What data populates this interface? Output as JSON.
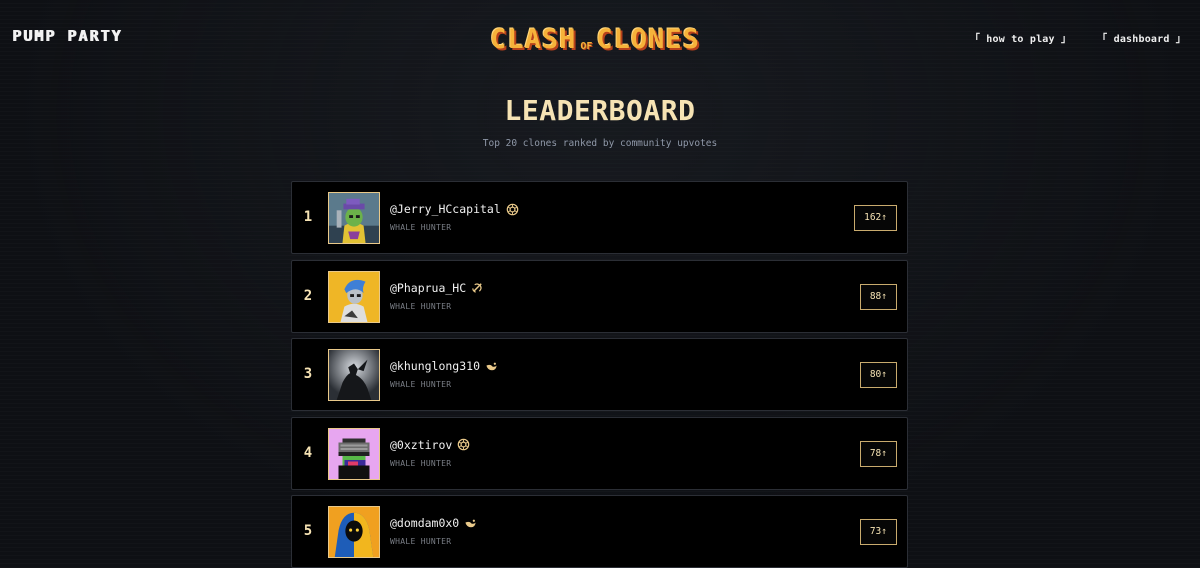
{
  "header": {
    "brand": "PUMP PARTY",
    "logo_left": "CLASH",
    "logo_of": "OF",
    "logo_right": "CLONES",
    "nav": [
      "「 how to play 」",
      "「 dashboard 」"
    ]
  },
  "page": {
    "title": "LEADERBOARD",
    "subtitle": "Top 20 clones ranked by community upvotes"
  },
  "leaderboard": [
    {
      "rank": "1",
      "handle": "@Jerry_HCcapital",
      "role": "WHALE HUNTER",
      "votes": "162↑",
      "badge_icon": "openai-icon",
      "avatar": "green-character-avatar"
    },
    {
      "rank": "2",
      "handle": "@Phaprua_HC",
      "role": "WHALE HUNTER",
      "votes": "88↑",
      "badge_icon": "grok-icon",
      "avatar": "blue-hair-character-avatar"
    },
    {
      "rank": "3",
      "handle": "@khunglong310",
      "role": "WHALE HUNTER",
      "votes": "80↑",
      "badge_icon": "deepseek-icon",
      "avatar": "silhouette-avatar"
    },
    {
      "rank": "4",
      "handle": "@0xztirov",
      "role": "WHALE HUNTER",
      "votes": "78↑",
      "badge_icon": "openai-icon",
      "avatar": "pixel-visor-avatar"
    },
    {
      "rank": "5",
      "handle": "@domdam0x0",
      "role": "WHALE HUNTER",
      "votes": "73↑",
      "badge_icon": "deepseek-icon",
      "avatar": "hooded-figure-avatar"
    }
  ],
  "colors": {
    "accent": "#f6e3b4",
    "logo_orange": "#f6b23a",
    "border_gold": "#c9ab6e"
  }
}
